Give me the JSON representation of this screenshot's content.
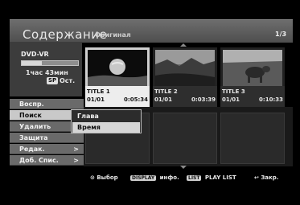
{
  "header": {
    "title": "Содержание",
    "subtitle": "Оригинал",
    "page": "1/3"
  },
  "disc": {
    "type": "DVD-VR",
    "time": "1час 43мин",
    "quality_badge": "SP",
    "remaining_label": "Ост.",
    "used_fraction": 0.35
  },
  "menu": {
    "items": [
      {
        "label": "Воспр.",
        "arrow": ""
      },
      {
        "label": "Поиск",
        "arrow": ">"
      },
      {
        "label": "Удалить",
        "arrow": ""
      },
      {
        "label": "Защита",
        "arrow": ""
      },
      {
        "label": "Редак.",
        "arrow": ">"
      },
      {
        "label": "Доб. Спис.",
        "arrow": ">"
      }
    ],
    "selected_index": 1
  },
  "submenu": {
    "items": [
      {
        "label": "Глава"
      },
      {
        "label": "Время"
      }
    ],
    "selected_index": 1
  },
  "titles": [
    {
      "title": "TITLE 1",
      "date": "01/01",
      "duration": "0:05:34",
      "thumbnail": "moon-over-ground"
    },
    {
      "title": "TITLE 2",
      "date": "01/01",
      "duration": "0:03:39",
      "thumbnail": "dark-landscape"
    },
    {
      "title": "TITLE 3",
      "date": "01/01",
      "duration": "0:10:33",
      "thumbnail": "animal-in-field"
    }
  ],
  "help": {
    "select_icon": "select-dial-icon",
    "select_label": "Выбор",
    "display_key": "DISPLAY",
    "display_label": "инфо.",
    "list_key": "LIST",
    "list_label": "PLAY LIST",
    "close_icon": "return-icon",
    "close_label": "Закр."
  }
}
